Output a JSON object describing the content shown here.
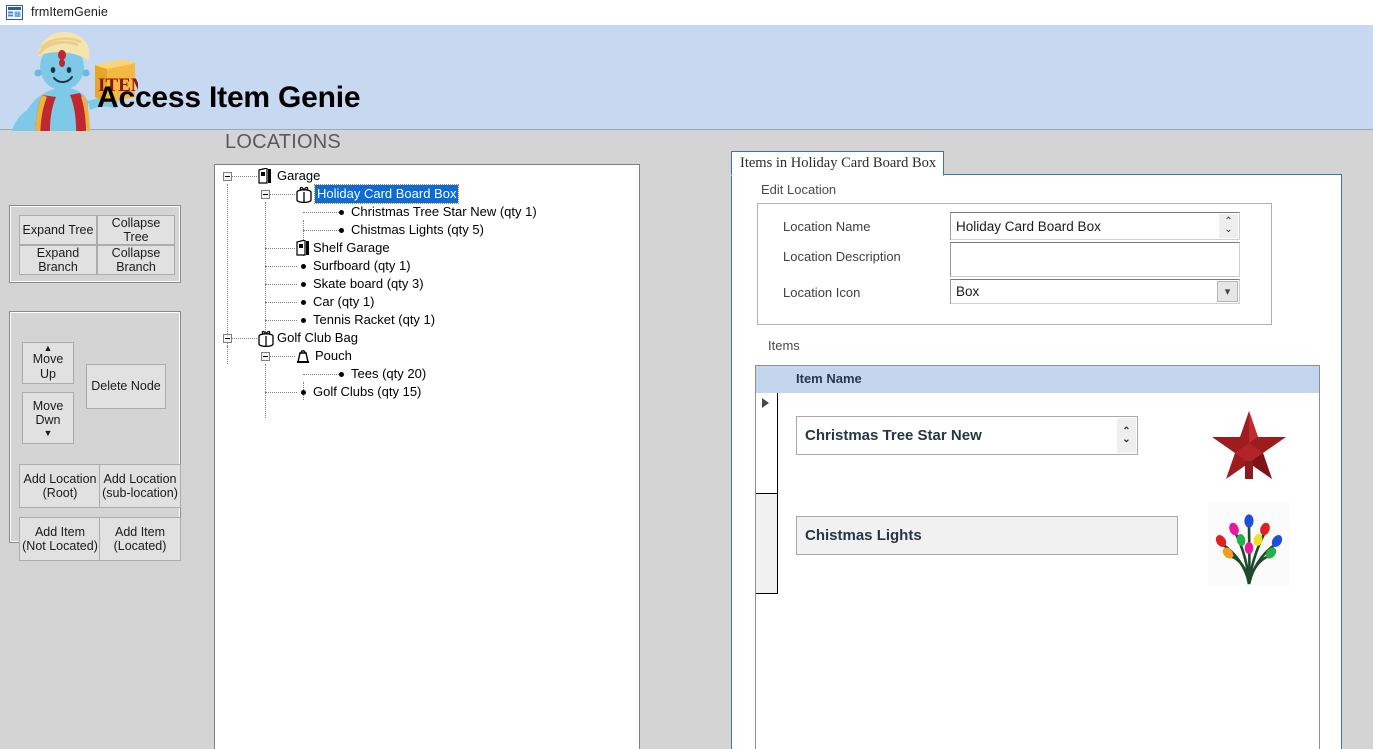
{
  "window": {
    "title": "frmItemGenie",
    "icon": "access-form-icon"
  },
  "banner": {
    "app_title": "Access Item Genie",
    "logo_icon": "genie-logo",
    "logo_box_text": "ITEM",
    "background_color": "#C6D9F1"
  },
  "left_panel": {
    "tree_buttons": [
      {
        "label": "Expand Tree",
        "name": "expand-tree-button"
      },
      {
        "label": "Collapse Tree",
        "name": "collapse-tree-button"
      },
      {
        "label": "Expand Branch",
        "name": "expand-branch-button"
      },
      {
        "label": "Collapse\nBranch",
        "name": "collapse-branch-button"
      }
    ],
    "edit_buttons": [
      {
        "label": "Move Up",
        "name": "move-up-button"
      },
      {
        "label": "Move\nDwn",
        "name": "move-down-button"
      },
      {
        "label": "Delete Node",
        "name": "delete-node-button"
      },
      {
        "label": "Add Location\n(Root)",
        "name": "add-location-root-button"
      },
      {
        "label": "Add Location\n(sub-location)",
        "name": "add-location-sub-button"
      },
      {
        "label": "Add Item\n(Not Located)",
        "name": "add-item-not-located-button"
      },
      {
        "label": "Add Item\n(Located)",
        "name": "add-item-located-button"
      }
    ]
  },
  "locations": {
    "heading": "LOCATIONS",
    "selected_node": "Holiday Card Board Box",
    "tree": [
      {
        "label": "Garage",
        "level": 0,
        "type": "location",
        "icon": "garage-icon",
        "expander": "minus"
      },
      {
        "label": "Holiday Card Board Box",
        "level": 1,
        "type": "location",
        "icon": "box-icon",
        "expander": "minus",
        "selected": true
      },
      {
        "label": "Christmas Tree Star New (qty 1)",
        "level": 2,
        "type": "item",
        "icon": "bullet-icon"
      },
      {
        "label": "Chistmas Lights (qty 5)",
        "level": 2,
        "type": "item",
        "icon": "bullet-icon"
      },
      {
        "label": "Shelf Garage",
        "level": 1,
        "type": "location",
        "icon": "garage-icon"
      },
      {
        "label": "Surfboard (qty 1)",
        "level": 1,
        "type": "item",
        "icon": "bullet-icon"
      },
      {
        "label": "Skate board (qty 3)",
        "level": 1,
        "type": "item",
        "icon": "bullet-icon"
      },
      {
        "label": "Car (qty 1)",
        "level": 1,
        "type": "item",
        "icon": "bullet-icon"
      },
      {
        "label": "Tennis Racket (qty 1)",
        "level": 1,
        "type": "item",
        "icon": "bullet-icon"
      },
      {
        "label": "Golf Club Bag",
        "level": 0,
        "type": "location",
        "icon": "box-icon",
        "expander": "minus"
      },
      {
        "label": "Pouch",
        "level": 1,
        "type": "location",
        "icon": "pouch-icon",
        "expander": "minus"
      },
      {
        "label": "Tees (qty 20)",
        "level": 2,
        "type": "item",
        "icon": "bullet-icon"
      },
      {
        "label": "Golf Clubs (qty 15)",
        "level": 1,
        "type": "item",
        "icon": "bullet-icon"
      }
    ]
  },
  "tab": {
    "label": "Items in Holiday Card Board Box"
  },
  "edit_location": {
    "section_label": "Edit Location",
    "fields": {
      "name_label": "Location Name",
      "name_value": "Holiday Card Board Box",
      "description_label": "Location Description",
      "description_value": "",
      "icon_label": "Location Icon",
      "icon_value": "Box"
    }
  },
  "items": {
    "section_label": "Items",
    "column_header": "Item Name",
    "rows": [
      {
        "name": "Christmas Tree Star New",
        "image": "red-star-tree-topper",
        "selected": true,
        "has_scrollbar": true
      },
      {
        "name": "Chistmas Lights",
        "image": "christmas-lights",
        "selected": false,
        "has_scrollbar": false
      }
    ]
  },
  "colors": {
    "banner": "#C6D9F1",
    "page_background": "#D4D4D4",
    "selection_blue": "#0A6CD4",
    "grid_header": "#C3D6EE",
    "tab_border": "#4472A8"
  }
}
